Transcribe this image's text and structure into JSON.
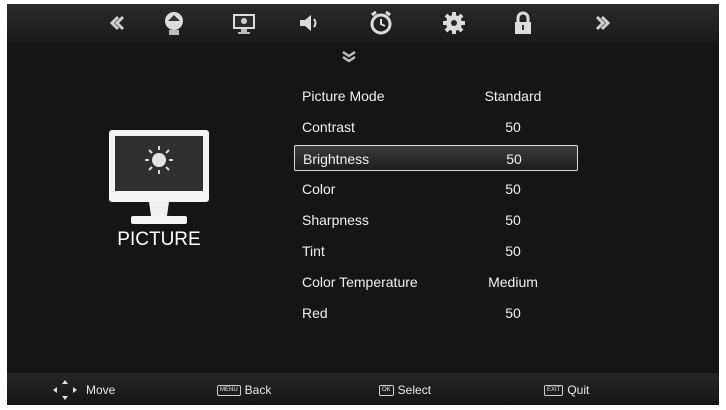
{
  "top_menu": [
    {
      "icon": "double-left-arrow-icon"
    },
    {
      "icon": "channel-icon"
    },
    {
      "icon": "picture-icon"
    },
    {
      "icon": "sound-icon"
    },
    {
      "icon": "time-icon"
    },
    {
      "icon": "setup-icon"
    },
    {
      "icon": "lock-icon"
    },
    {
      "icon": "double-right-arrow-icon"
    }
  ],
  "section": {
    "title": "PICTURE",
    "icon": "picture-monitor-icon"
  },
  "menu": [
    {
      "label": "Picture Mode",
      "value": "Standard",
      "selected": false
    },
    {
      "label": "Contrast",
      "value": "50",
      "selected": false
    },
    {
      "label": "Brightness",
      "value": "50",
      "selected": true
    },
    {
      "label": "Color",
      "value": "50",
      "selected": false
    },
    {
      "label": "Sharpness",
      "value": "50",
      "selected": false
    },
    {
      "label": "Tint",
      "value": "50",
      "selected": false
    },
    {
      "label": "Color Temperature",
      "value": "Medium",
      "selected": false
    },
    {
      "label": "Red",
      "value": "50",
      "selected": false
    }
  ],
  "footer": {
    "move": "Move",
    "back_key": "MENU",
    "back": "Back",
    "select_key": "OK",
    "select": "Select",
    "quit_key": "EXIT",
    "quit": "Quit"
  },
  "colors": {
    "background": "#151515",
    "highlight_border": "#d8d8d8",
    "text": "#f0f0f0"
  }
}
